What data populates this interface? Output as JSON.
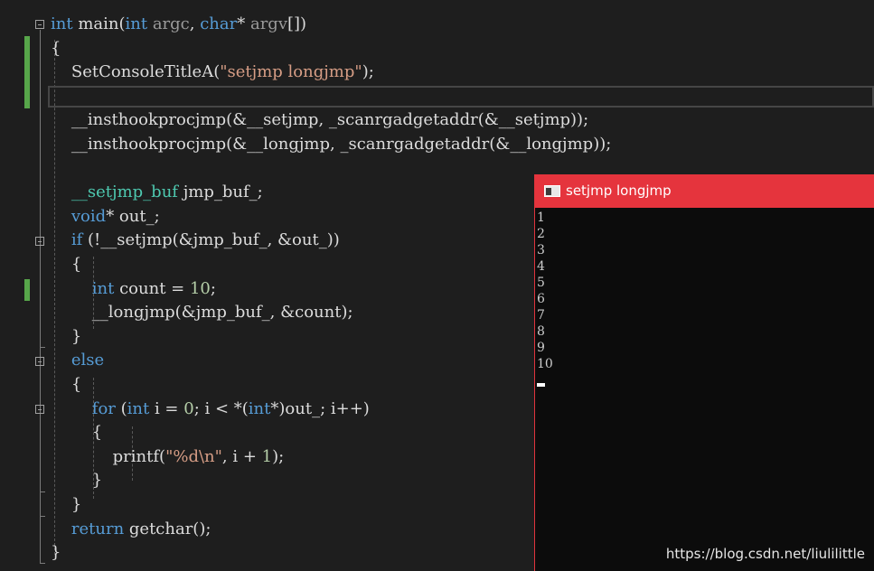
{
  "editor": {
    "lines": [
      {
        "parts": [
          {
            "c": "kw",
            "t": "int"
          },
          {
            "c": "fn",
            "t": " main("
          },
          {
            "c": "kw",
            "t": "int"
          },
          {
            "c": "param",
            "t": " argc"
          },
          {
            "c": "fn",
            "t": ", "
          },
          {
            "c": "kw",
            "t": "char"
          },
          {
            "c": "fn",
            "t": "* "
          },
          {
            "c": "param",
            "t": "argv"
          },
          {
            "c": "fn",
            "t": "[])"
          }
        ]
      },
      {
        "parts": [
          {
            "c": "fn",
            "t": "{"
          }
        ]
      },
      {
        "parts": [
          {
            "c": "fn",
            "t": "    SetConsoleTitleA("
          },
          {
            "c": "str",
            "t": "\"setjmp longjmp\""
          },
          {
            "c": "fn",
            "t": ");"
          }
        ]
      },
      {
        "parts": [
          {
            "c": "fn",
            "t": ""
          }
        ]
      },
      {
        "parts": [
          {
            "c": "fn",
            "t": "    __insthookprocjmp(&__setjmp, _scanrgadgetaddr(&__setjmp));"
          }
        ]
      },
      {
        "parts": [
          {
            "c": "fn",
            "t": "    __insthookprocjmp(&__longjmp, _scanrgadgetaddr(&__longjmp));"
          }
        ]
      },
      {
        "parts": [
          {
            "c": "fn",
            "t": ""
          }
        ]
      },
      {
        "parts": [
          {
            "c": "fn",
            "t": "    "
          },
          {
            "c": "ty",
            "t": "__setjmp_buf"
          },
          {
            "c": "fn",
            "t": " jmp_buf_;"
          }
        ]
      },
      {
        "parts": [
          {
            "c": "fn",
            "t": "    "
          },
          {
            "c": "kw",
            "t": "void"
          },
          {
            "c": "fn",
            "t": "* out_;"
          }
        ]
      },
      {
        "parts": [
          {
            "c": "fn",
            "t": "    "
          },
          {
            "c": "kw",
            "t": "if"
          },
          {
            "c": "fn",
            "t": " (!__setjmp(&jmp_buf_, &out_))"
          }
        ]
      },
      {
        "parts": [
          {
            "c": "fn",
            "t": "    {"
          }
        ]
      },
      {
        "parts": [
          {
            "c": "fn",
            "t": "        "
          },
          {
            "c": "kw",
            "t": "int"
          },
          {
            "c": "fn",
            "t": " count = "
          },
          {
            "c": "num",
            "t": "10"
          },
          {
            "c": "fn",
            "t": ";"
          }
        ]
      },
      {
        "parts": [
          {
            "c": "fn",
            "t": "        __longjmp(&jmp_buf_, &count);"
          }
        ]
      },
      {
        "parts": [
          {
            "c": "fn",
            "t": "    }"
          }
        ]
      },
      {
        "parts": [
          {
            "c": "fn",
            "t": "    "
          },
          {
            "c": "kw",
            "t": "else"
          }
        ]
      },
      {
        "parts": [
          {
            "c": "fn",
            "t": "    {"
          }
        ]
      },
      {
        "parts": [
          {
            "c": "fn",
            "t": "        "
          },
          {
            "c": "kw",
            "t": "for"
          },
          {
            "c": "fn",
            "t": " ("
          },
          {
            "c": "kw",
            "t": "int"
          },
          {
            "c": "fn",
            "t": " i = "
          },
          {
            "c": "num",
            "t": "0"
          },
          {
            "c": "fn",
            "t": "; i < *("
          },
          {
            "c": "kw",
            "t": "int"
          },
          {
            "c": "fn",
            "t": "*)out_; i++)"
          }
        ]
      },
      {
        "parts": [
          {
            "c": "fn",
            "t": "        {"
          }
        ]
      },
      {
        "parts": [
          {
            "c": "fn",
            "t": "            printf("
          },
          {
            "c": "str",
            "t": "\"%d\\n\""
          },
          {
            "c": "fn",
            "t": ", i + "
          },
          {
            "c": "num",
            "t": "1"
          },
          {
            "c": "fn",
            "t": ");"
          }
        ]
      },
      {
        "parts": [
          {
            "c": "fn",
            "t": "        }"
          }
        ]
      },
      {
        "parts": [
          {
            "c": "fn",
            "t": "    }"
          }
        ]
      },
      {
        "parts": [
          {
            "c": "fn",
            "t": "    "
          },
          {
            "c": "kw",
            "t": "return"
          },
          {
            "c": "fn",
            "t": " getchar();"
          }
        ]
      },
      {
        "parts": [
          {
            "c": "fn",
            "t": "}"
          }
        ]
      }
    ]
  },
  "console": {
    "title": "setjmp longjmp",
    "output": [
      "1",
      "2",
      "3",
      "4",
      "5",
      "6",
      "7",
      "8",
      "9",
      "10"
    ]
  },
  "watermark": "https://blog.csdn.net/liulilittle",
  "colors": {
    "keyword": "#569cd6",
    "type": "#4ec9b0",
    "string": "#d69d85",
    "number": "#b5cea8",
    "console_titlebar": "#e5343d"
  }
}
